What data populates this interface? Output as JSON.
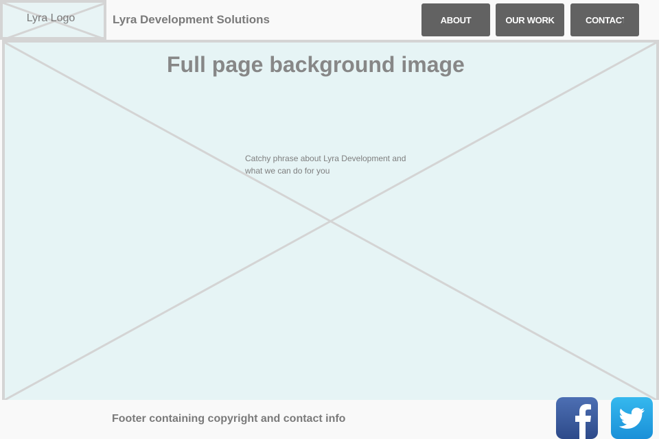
{
  "header": {
    "logo_text": "Lyra Logo",
    "site_title": "Lyra Development Solutions",
    "nav": {
      "about": "ABOUT",
      "our_work": "OUR WORK",
      "contact": "CONTACT"
    }
  },
  "hero": {
    "title": "Full page background image",
    "tagline": "Catchy phrase about Lyra Development and what we can do for you"
  },
  "footer": {
    "text": "Footer containing copyright and contact info",
    "social": [
      "facebook-icon",
      "twitter-icon"
    ]
  },
  "colors": {
    "placeholder_fill": "#e6f4f5",
    "placeholder_stroke": "#d4d4d4",
    "nav_button": "#626262",
    "facebook": "#3b5998",
    "twitter": "#1da1f2"
  }
}
